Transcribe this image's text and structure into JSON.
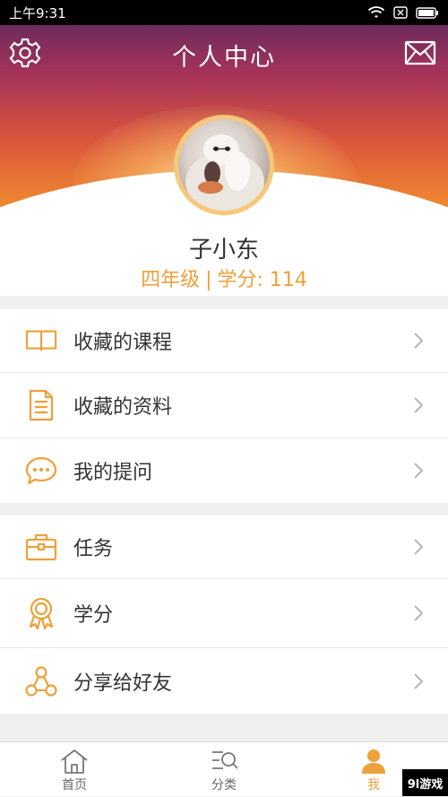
{
  "status_bar": {
    "time": "上午9:31"
  },
  "header": {
    "title": "个人中心",
    "settings_icon": "gear-icon",
    "message_icon": "mail-icon"
  },
  "profile": {
    "name": "子小东",
    "grade": "四年级",
    "separator": "|",
    "credits_label": "学分: 114"
  },
  "menu_groups": [
    {
      "items": [
        {
          "label": "收藏的课程",
          "icon": "book-icon"
        },
        {
          "label": "收藏的资料",
          "icon": "document-icon"
        },
        {
          "label": "我的提问",
          "icon": "chat-bubble-icon"
        }
      ]
    },
    {
      "items": [
        {
          "label": "任务",
          "icon": "briefcase-icon"
        },
        {
          "label": "学分",
          "icon": "award-ribbon-icon"
        },
        {
          "label": "分享给好友",
          "icon": "share-icon"
        }
      ]
    }
  ],
  "tabbar": {
    "tabs": [
      {
        "label": "首页",
        "icon": "home-icon",
        "active": false
      },
      {
        "label": "分类",
        "icon": "category-search-icon",
        "active": false
      },
      {
        "label": "我",
        "icon": "user-icon",
        "active": true
      }
    ]
  },
  "watermark": {
    "text": "9l游戏"
  },
  "colors": {
    "accent": "#eea03a",
    "text": "#333333",
    "background": "#f0f0f0"
  }
}
